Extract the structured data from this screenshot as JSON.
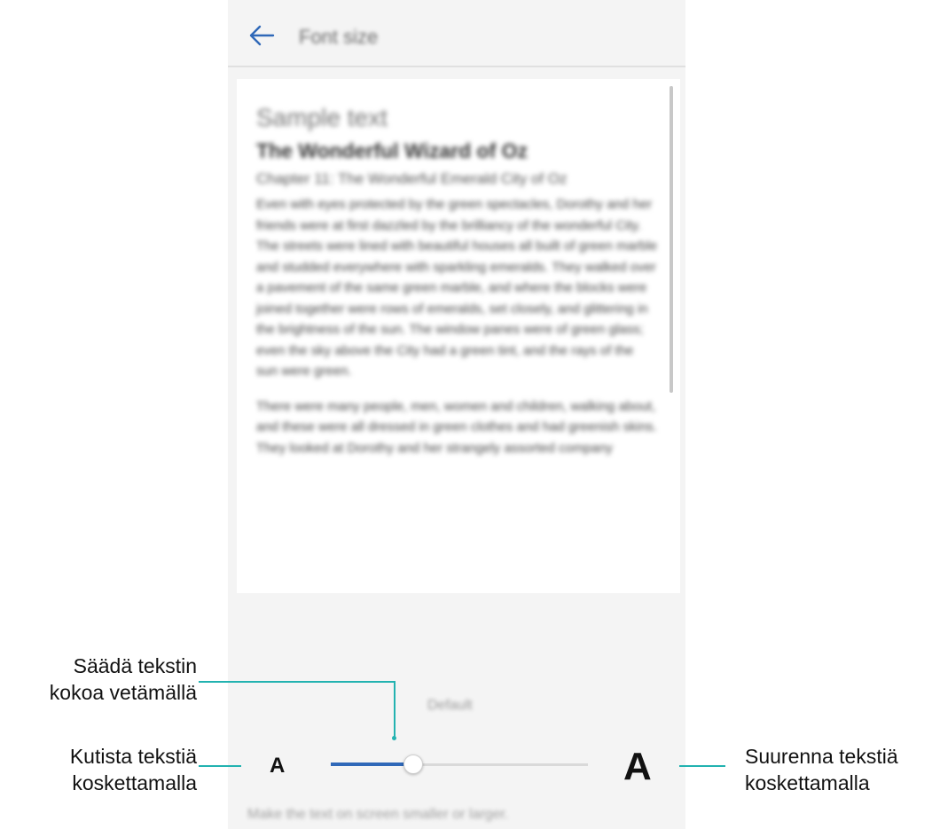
{
  "screen": {
    "title": "Font size",
    "back_icon": "arrow-left-icon",
    "accent_color": "#2f68b8"
  },
  "preview": {
    "sample_title": "Sample text",
    "book_title": "The Wonderful Wizard of Oz",
    "chapter_title": "Chapter 11: The Wonderful Emerald City of Oz",
    "paragraph_1": "Even with eyes protected by the green spectacles, Dorothy and her friends were at first dazzled by the brilliancy of the wonderful City. The streets were lined with beautiful houses all built of green marble and studded everywhere with sparkling emeralds. They walked over a pavement of the same green marble, and where the blocks were joined together were rows of emeralds, set closely, and glittering in the brightness of the sun. The window panes were of green glass; even the sky above the City had a green tint, and the rays of the sun were green.",
    "paragraph_2": "There were many people, men, women and children, walking about, and these were all dressed in green clothes and had greenish skins. They looked at Dorothy and her strangely assorted company"
  },
  "font_control": {
    "default_label": "Default",
    "small_label": "A",
    "large_label": "A",
    "slider_level": 0.32,
    "hint": "Make the text on screen smaller or larger."
  },
  "annotations": {
    "drag_line1": "Säädä tekstin",
    "drag_line2": "kokoa vetämällä",
    "shrink_line1": "Kutista tekstiä",
    "shrink_line2": "koskettamalla",
    "enlarge_line1": "Suurenna tekstiä",
    "enlarge_line2": "koskettamalla",
    "leader_color": "#22b2b0"
  }
}
